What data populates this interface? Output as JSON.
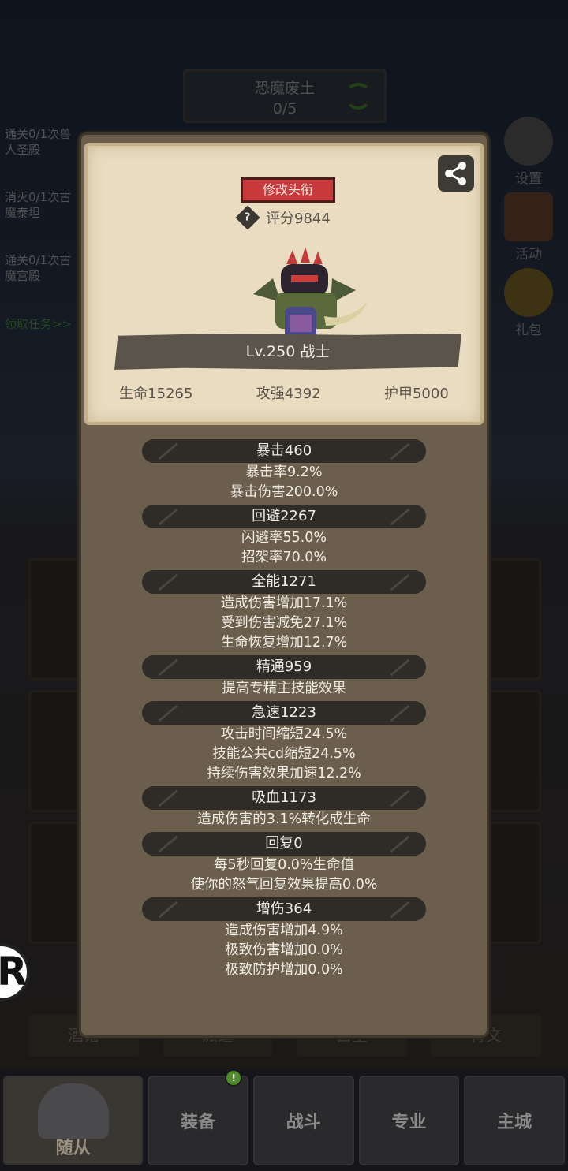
{
  "background": {
    "zone_name": "恐魔废土",
    "zone_progress": "0/5",
    "tasks": [
      {
        "line1": "通关0/1次兽",
        "line2": "人圣殿"
      },
      {
        "line1": "消灭0/1次古",
        "line2": "魔泰坦"
      },
      {
        "line1": "通关0/1次古",
        "line2": "魔宫殿"
      }
    ],
    "task_link": "领取任务>>",
    "side_buttons": [
      {
        "label": "设置",
        "icon": "gear-icon"
      },
      {
        "label": "活动",
        "icon": "activity-scroll-icon"
      },
      {
        "label": "礼包",
        "icon": "gift-icon"
      }
    ],
    "sub_tabs": [
      "酒馆",
      "派遣",
      "占星",
      "符文"
    ]
  },
  "bottom_nav": [
    {
      "label": "随从",
      "active": true
    },
    {
      "label": "装备",
      "badge": "!"
    },
    {
      "label": "战斗"
    },
    {
      "label": "专业"
    },
    {
      "label": "主城"
    }
  ],
  "side_badge": "R",
  "profile": {
    "change_title_label": "修改头衔",
    "rating": "评分9844",
    "level_class": "Lv.250 战士",
    "hp": "生命15265",
    "attack": "攻强4392",
    "armor": "护甲5000"
  },
  "stat_groups": [
    {
      "head": "暴击460",
      "lines": [
        "暴击率9.2%",
        "暴击伤害200.0%"
      ]
    },
    {
      "head": "回避2267",
      "lines": [
        "闪避率55.0%",
        "招架率70.0%"
      ]
    },
    {
      "head": "全能1271",
      "lines": [
        "造成伤害增加17.1%",
        "受到伤害减免27.1%",
        "生命恢复增加12.7%"
      ]
    },
    {
      "head": "精通959",
      "lines": [
        "提高专精主技能效果"
      ]
    },
    {
      "head": "急速1223",
      "lines": [
        "攻击时间缩短24.5%",
        "技能公共cd缩短24.5%",
        "持续伤害效果加速12.2%"
      ]
    },
    {
      "head": "吸血1173",
      "lines": [
        "造成伤害的3.1%转化成生命"
      ]
    },
    {
      "head": "回复0",
      "lines": [
        "每5秒回复0.0%生命值",
        "使你的怒气回复效果提高0.0%"
      ]
    },
    {
      "head": "增伤364",
      "lines": [
        "造成伤害增加4.9%",
        "极致伤害增加0.0%",
        "极致防护增加0.0%"
      ]
    }
  ]
}
